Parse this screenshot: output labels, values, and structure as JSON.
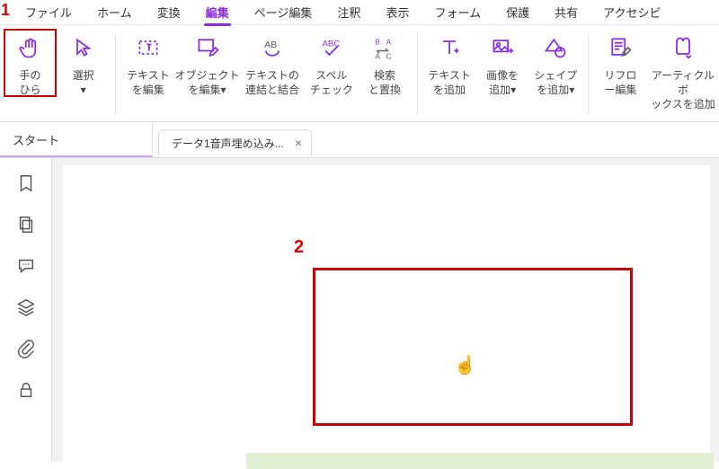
{
  "annotations": {
    "a1": "1",
    "a2": "2"
  },
  "menu": {
    "items": [
      "ファイル",
      "ホーム",
      "変換",
      "編集",
      "ページ編集",
      "注釈",
      "表示",
      "フォーム",
      "保護",
      "共有",
      "アクセシビ"
    ],
    "activeIndex": 3
  },
  "ribbon": {
    "hand": "手の\nひら",
    "select": "選択\n▾",
    "editText": "テキスト\nを編集",
    "editObject": "オブジェクト\nを編集▾",
    "linkJoin": "テキストの\n連結と結合",
    "spell": "スペル\nチェック",
    "findReplace": "検索\nと置換",
    "addText": "テキスト\nを追加",
    "addImage": "画像を\n追加▾",
    "addShape": "シェイプ\nを追加▾",
    "reflow": "リフロ\nー編集",
    "article": "アーティクルボ\nックスを追加"
  },
  "tabs": {
    "start": "スタート",
    "doc": "データ1音声埋め込み...",
    "close": "×"
  },
  "cursor": "☝"
}
